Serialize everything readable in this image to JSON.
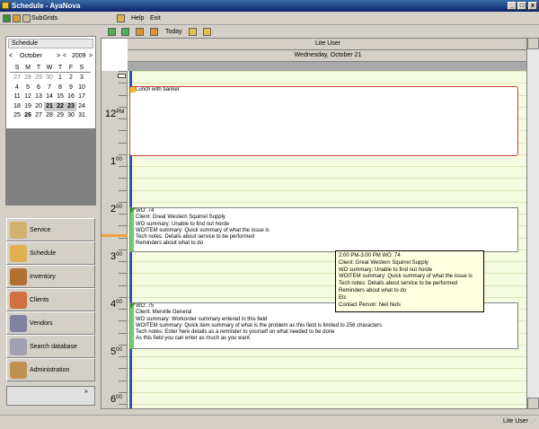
{
  "window": {
    "title": "Schedule - AyaNova",
    "min": "_",
    "max": "□",
    "close": "x"
  },
  "menubar": {
    "subgrids": "SubGrids",
    "help": "Help",
    "exit": "Exit"
  },
  "toolbar": {
    "today": "Today"
  },
  "calendar": {
    "header": "Schedule",
    "month": "October",
    "year": "2009",
    "nav_prev": "<",
    "nav_next": ">",
    "dow": [
      "S",
      "M",
      "T",
      "W",
      "T",
      "F",
      "S"
    ],
    "weeks": [
      [
        "27",
        "28",
        "29",
        "30",
        "1",
        "2",
        "3"
      ],
      [
        "4",
        "5",
        "6",
        "7",
        "8",
        "9",
        "10"
      ],
      [
        "11",
        "12",
        "13",
        "14",
        "15",
        "16",
        "17"
      ],
      [
        "18",
        "19",
        "20",
        "21",
        "22",
        "23",
        "24"
      ],
      [
        "25",
        "26",
        "27",
        "28",
        "29",
        "30",
        "31"
      ]
    ]
  },
  "nav": [
    "Service",
    "Schedule",
    "Inventory",
    "Clients",
    "Vendors",
    "Search database",
    "Administration"
  ],
  "scheduler": {
    "user": "Lite User",
    "date": "Wednesday, October 21",
    "times": [
      {
        "h": "12",
        "m": "PM"
      },
      {
        "h": "1",
        "m": "00"
      },
      {
        "h": "2",
        "m": "00"
      },
      {
        "h": "3",
        "m": "00"
      },
      {
        "h": "4",
        "m": "00"
      },
      {
        "h": "5",
        "m": "00"
      },
      {
        "h": "6",
        "m": "00"
      }
    ]
  },
  "appt1": {
    "text": "Lunch with banker"
  },
  "appt2": {
    "lines": [
      "WO: 74",
      "Client:  Great Western Squirrel Supply",
      "WO summary: Unable to find nut horde",
      "WOITEM summary: Quick summary of what the issue is",
      "Tech notes: Details about service to be performed",
      "Reminders about what to do"
    ]
  },
  "appt3": {
    "lines": [
      "WO: 75",
      "Client:  Merville General",
      "WO summary: Workorder summary entered in this field",
      "WOITEM summary: Quick item summary of what is the problem as this field is limited to 256 characters",
      "Tech notes: Enter here details as a reminder to yourself on what needed to be done",
      "As this field you can enter as much as you want."
    ]
  },
  "tooltip": {
    "lines": [
      "2:00 PM-3:00 PM WO: 74",
      "Client:  Great Western Squirrel Supply",
      "WO summary: Unable to find nut horde",
      "WOITEM summary: Quick summary of what the issue is",
      "Tech notes: Details about service to be performed",
      "Reminders about what to do",
      "Etc",
      "Contact Person:  Neil Nuts"
    ]
  },
  "status": {
    "user": "Lite User"
  }
}
